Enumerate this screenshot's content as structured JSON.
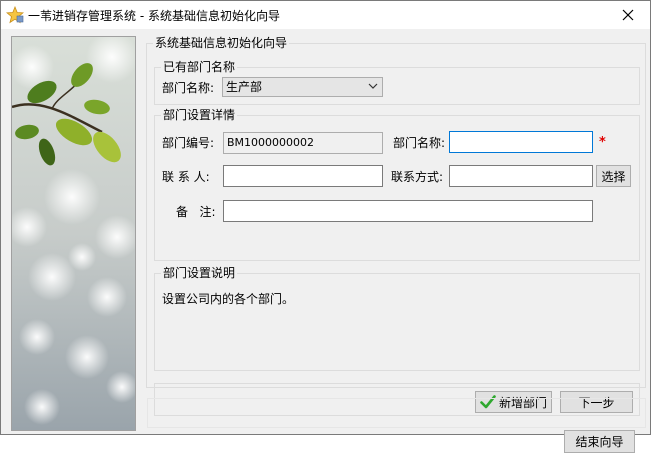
{
  "window": {
    "title": "一苇进销存管理系统 - 系统基础信息初始化向导"
  },
  "wizard": {
    "title": "系统基础信息初始化向导",
    "existing_group": {
      "title": "已有部门名称",
      "dept_label": "部门名称:",
      "dept_selected": "生产部"
    },
    "detail_group": {
      "title": "部门设置详情",
      "code_label": "部门编号:",
      "code_value": "BM1000000002",
      "name_label": "部门名称:",
      "name_value": "",
      "required_mark": "*",
      "contact_label": "联 系 人:",
      "contact_value": "",
      "phone_label": "联系方式:",
      "phone_value": "",
      "select_button": "选择",
      "remark_label": "备   注:",
      "remark_value": ""
    },
    "description_group": {
      "title": "部门设置说明",
      "text": "设置公司内的各个部门。"
    },
    "buttons": {
      "add_dept": "新增部门",
      "next": "下一步",
      "finish": "结束向导"
    }
  },
  "colors": {
    "accent": "#0078d7",
    "required": "#e00000",
    "check_icon": "#2fa82f"
  }
}
